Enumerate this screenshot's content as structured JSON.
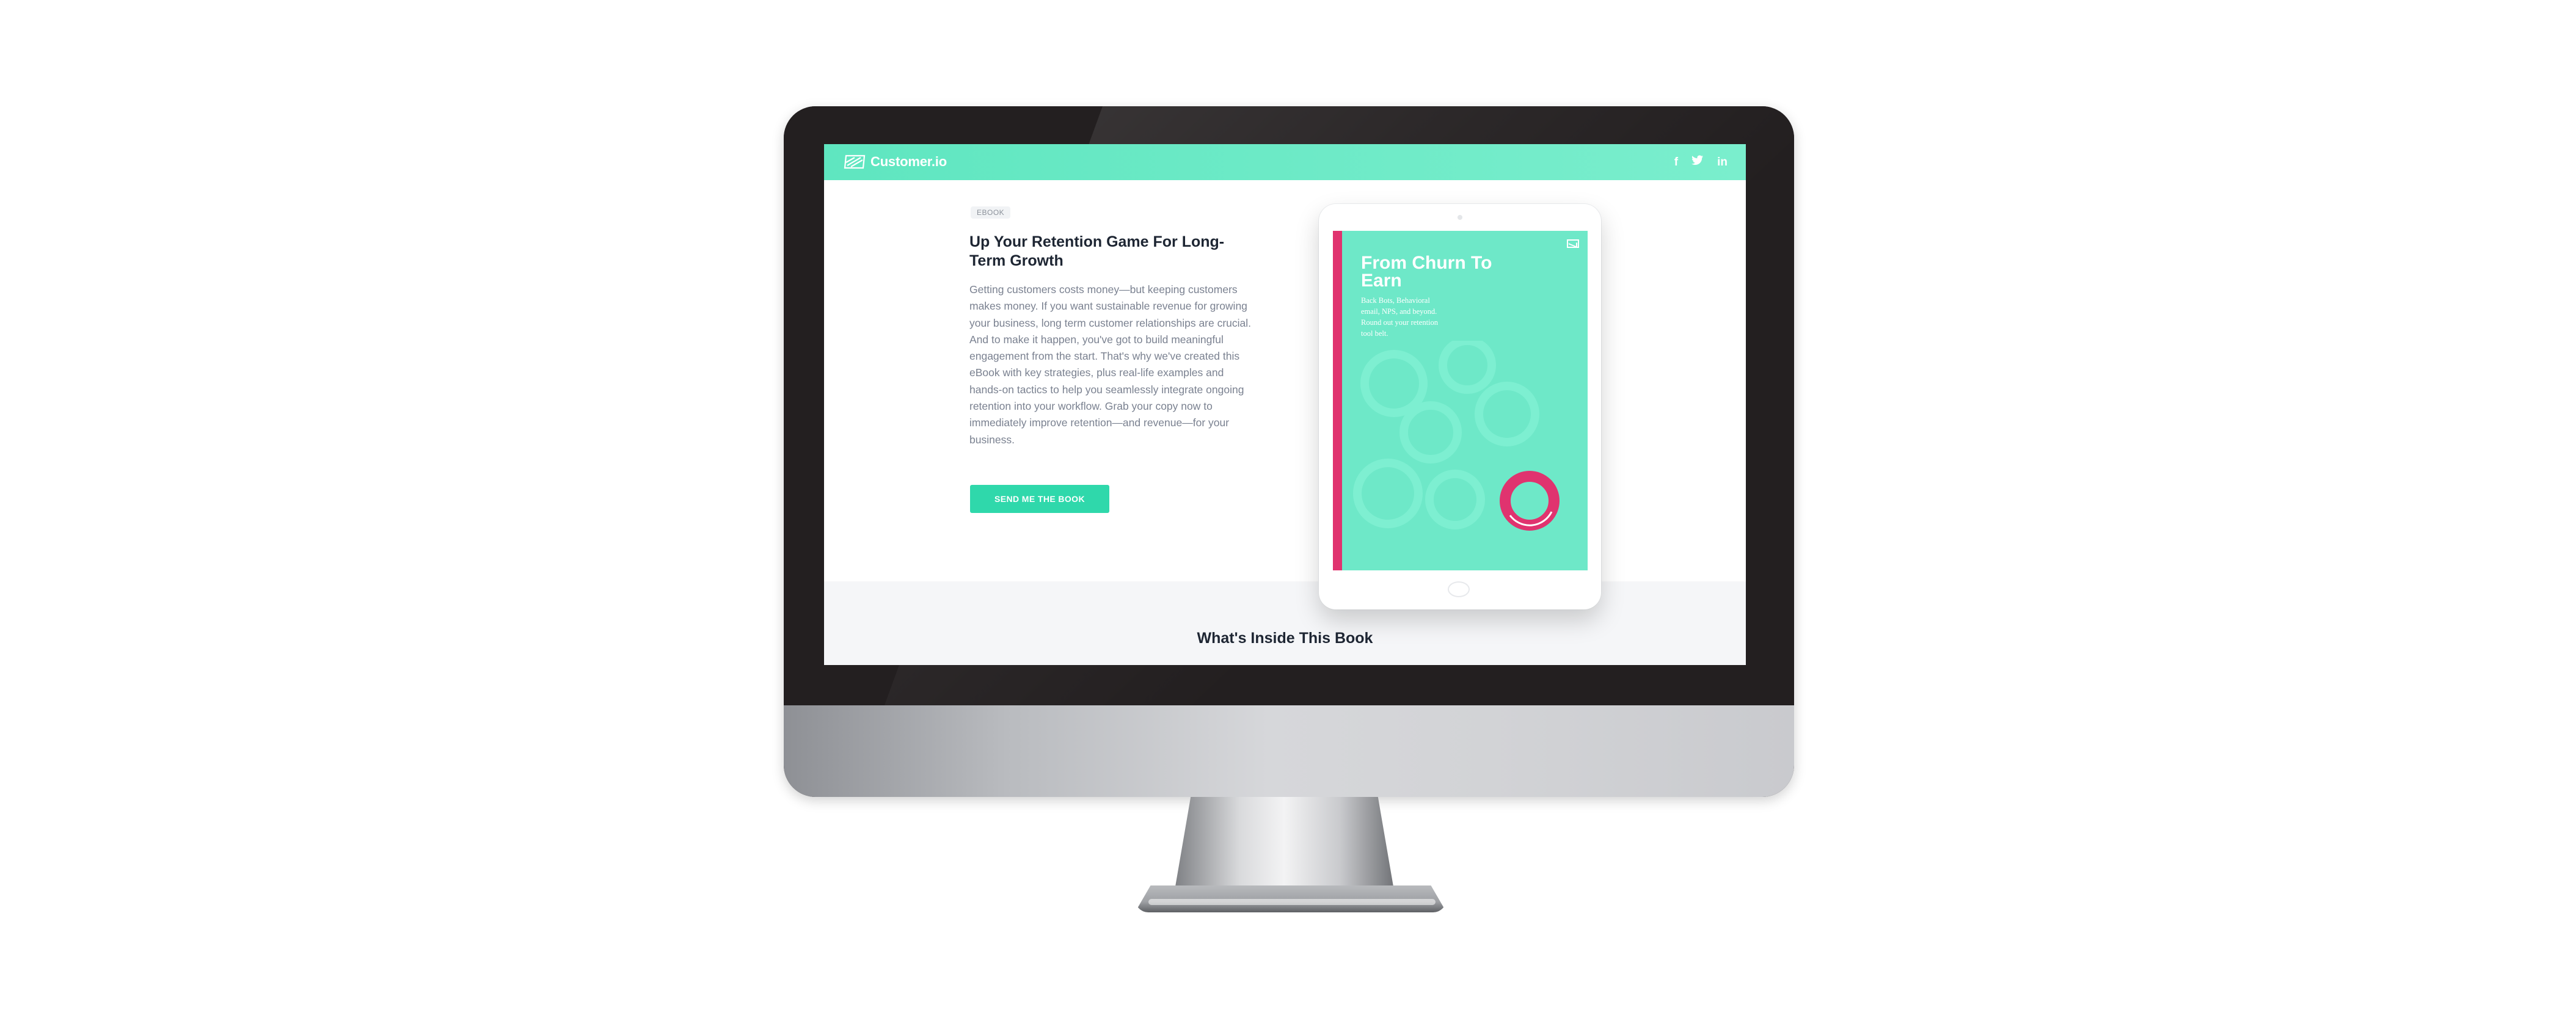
{
  "brand": {
    "name": "Customer.io",
    "accent_color": "#6fe9c7",
    "cta_color": "#2fd8ab",
    "spine_color": "#e0336f"
  },
  "nav": {
    "logo_icon": "customer-io-logo-icon",
    "social": [
      {
        "icon": "facebook-icon",
        "glyph": "f"
      },
      {
        "icon": "twitter-icon",
        "glyph": "t"
      },
      {
        "icon": "linkedin-icon",
        "glyph": "in"
      }
    ]
  },
  "hero": {
    "badge": "EBOOK",
    "headline": "Up Your Retention Game For Long-Term Growth",
    "body": "Getting customers costs money—but keeping customers makes money. If you want sustainable revenue for growing your business, long term customer relationships are crucial. And to make it happen, you've got to build meaningful engagement from the start. That's why we've created this eBook with key strategies, plus real-life examples and hands-on tactics to help you seamlessly integrate ongoing retention into your workflow. Grab your copy now to immediately improve retention—and revenue—for your business.",
    "cta_label": "SEND ME THE BOOK"
  },
  "book_cover": {
    "title": "From Churn To Earn",
    "subtitle": "Back Bots, Behavioral email, NPS, and beyond. Round out your retention tool belt."
  },
  "section": {
    "title": "What's Inside This Book"
  }
}
